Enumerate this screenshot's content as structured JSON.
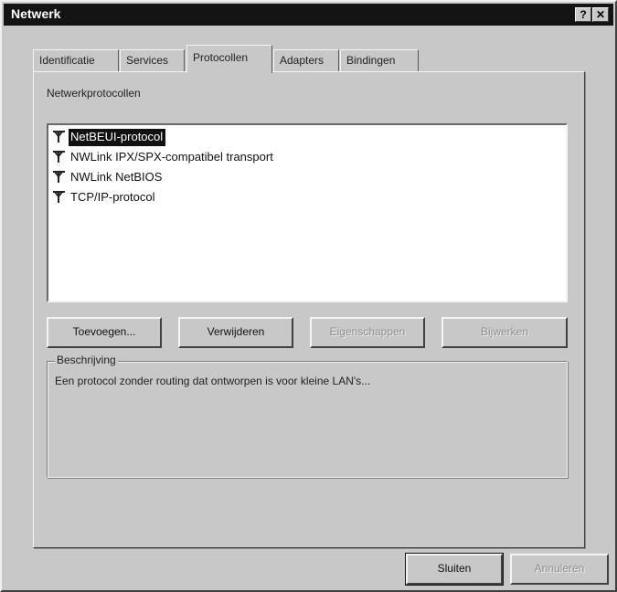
{
  "window": {
    "title": "Netwerk",
    "help_glyph": "?",
    "close_glyph": "✕"
  },
  "tabs": [
    {
      "label": "Identificatie",
      "active": false
    },
    {
      "label": "Services",
      "active": false
    },
    {
      "label": "Protocollen",
      "active": true
    },
    {
      "label": "Adapters",
      "active": false
    },
    {
      "label": "Bindingen",
      "active": false
    }
  ],
  "protocols": {
    "section_label": "Netwerkprotocollen",
    "items": [
      {
        "label": "NetBEUI-protocol",
        "selected": true,
        "icon": "network-protocol-icon"
      },
      {
        "label": "NWLink IPX/SPX-compatibel transport",
        "selected": false,
        "icon": "network-protocol-icon"
      },
      {
        "label": "NWLink NetBIOS",
        "selected": false,
        "icon": "network-protocol-icon"
      },
      {
        "label": "TCP/IP-protocol",
        "selected": false,
        "icon": "network-protocol-icon"
      }
    ]
  },
  "actions": {
    "add": "Toevoegen...",
    "remove": "Verwijderen",
    "properties": "Eigenschappen",
    "update": "Bijwerken"
  },
  "description": {
    "title": "Beschrijving",
    "text": "Een protocol zonder routing dat ontworpen is voor kleine LAN's..."
  },
  "footer": {
    "close": "Sluiten",
    "cancel": "Annuleren"
  },
  "colors": {
    "titlebar": "#141414",
    "face": "#c8c8c8",
    "selection": "#111111"
  }
}
